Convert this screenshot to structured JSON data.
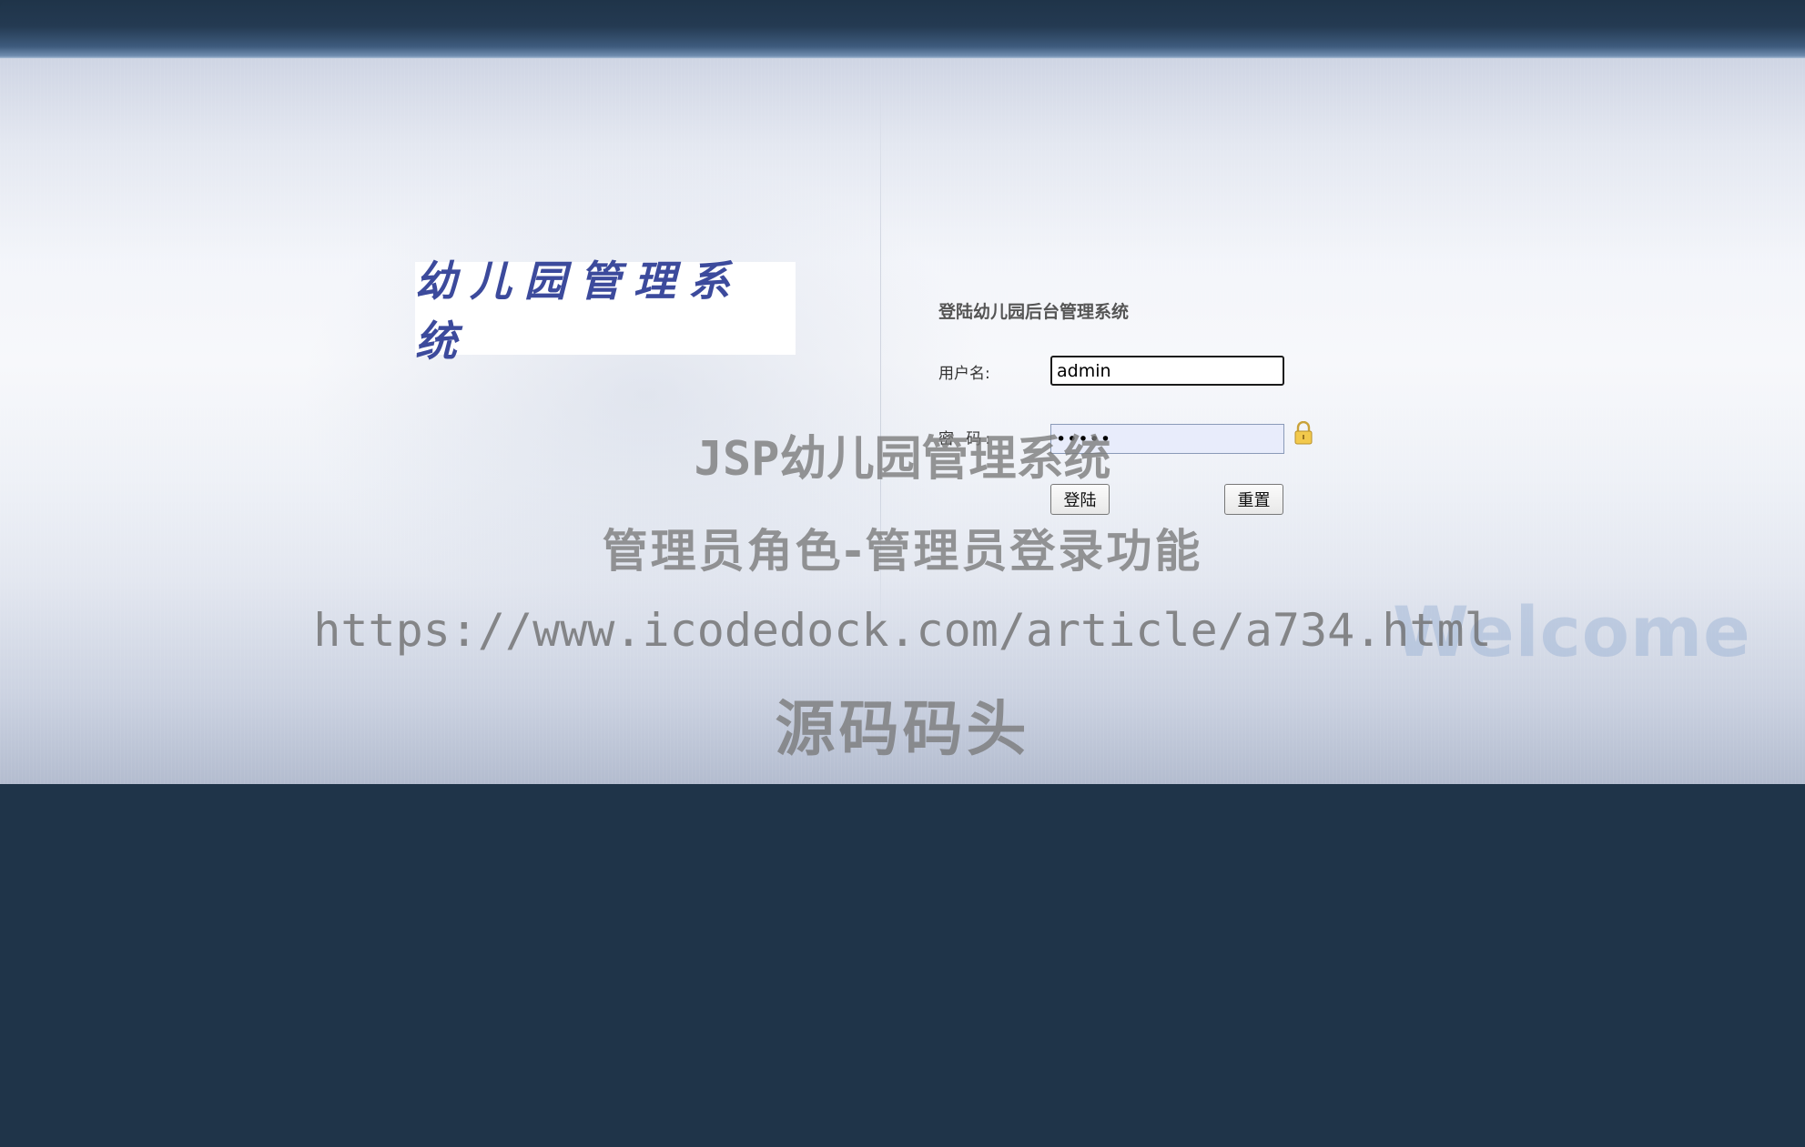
{
  "logo": {
    "text": "幼儿园管理系统"
  },
  "form": {
    "title": "登陆幼儿园后台管理系统",
    "username_label": "用户名:",
    "username_value": "admin",
    "password_label": "密 码:",
    "password_value": "•••••",
    "login_button": "登陆",
    "reset_button": "重置"
  },
  "background": {
    "welcome_text": "Welcome"
  },
  "watermark": {
    "line1": "JSP幼儿园管理系统",
    "line2": "管理员角色-管理员登录功能",
    "line3": "https://www.icodedock.com/article/a734.html",
    "line4": "源码码头"
  },
  "icons": {
    "lock": "lock-icon"
  },
  "colors": {
    "frame": "#1f3449",
    "logo_text": "#3c4a9c",
    "password_field_bg": "#e8ecfb"
  }
}
